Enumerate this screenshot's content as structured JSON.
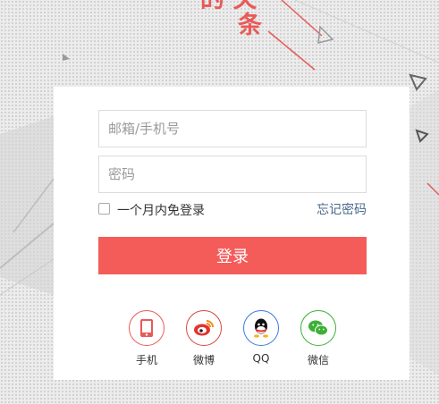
{
  "slogan": {
    "line1": "的 关",
    "line2": "条"
  },
  "form": {
    "account_placeholder": "邮箱/手机号",
    "password_placeholder": "密码",
    "remember_label": "一个月内免登录",
    "forgot_label": "忘记密码",
    "login_label": "登录"
  },
  "social": [
    {
      "label": "手机",
      "icon": "phone-icon",
      "color": "#e85a58"
    },
    {
      "label": "微博",
      "icon": "weibo-icon",
      "color": "#d9463f"
    },
    {
      "label": "QQ",
      "icon": "qq-icon",
      "color": "#3a7bd5"
    },
    {
      "label": "微信",
      "icon": "wechat-icon",
      "color": "#3cb035"
    }
  ],
  "colors": {
    "accent": "#f45c5a",
    "link": "#4a6a8a",
    "background": "#ececec"
  }
}
